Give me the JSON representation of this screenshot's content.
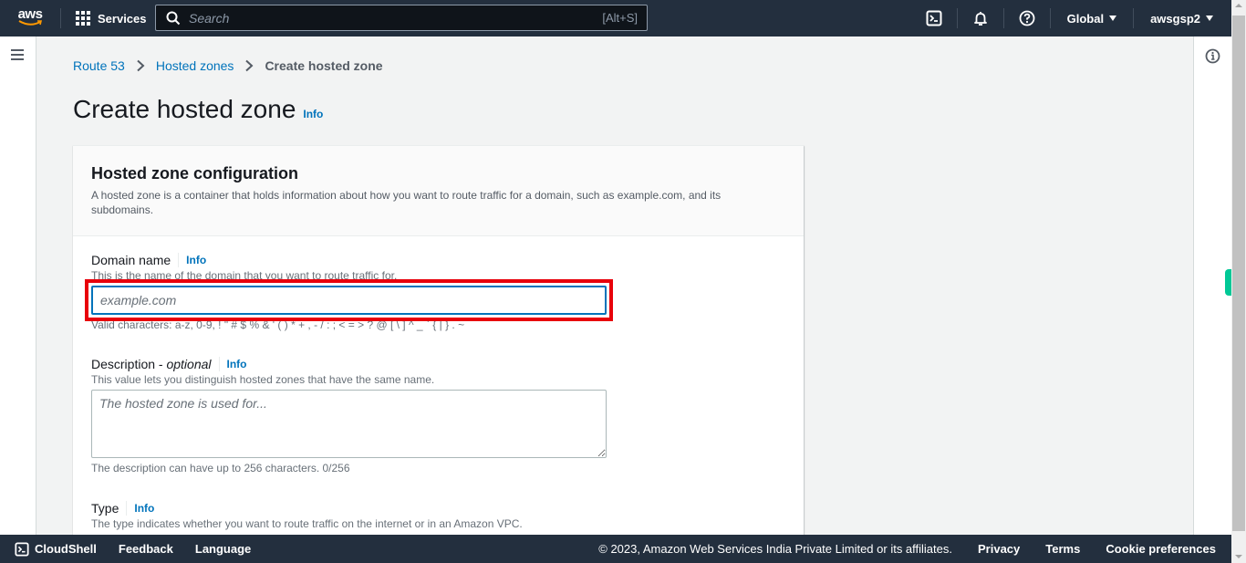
{
  "topnav": {
    "logo_text": "aws",
    "services_label": "Services",
    "search_placeholder": "Search",
    "search_shortcut": "[Alt+S]",
    "region_label": "Global",
    "account_label": "awsgsp2",
    "icons": [
      "cloudshell-icon",
      "notifications-bell-icon",
      "help-icon"
    ]
  },
  "breadcrumb": [
    {
      "label": "Route 53",
      "link": true
    },
    {
      "label": "Hosted zones",
      "link": true
    },
    {
      "label": "Create hosted zone",
      "link": false
    }
  ],
  "page": {
    "title": "Create hosted zone",
    "info_label": "Info"
  },
  "panel": {
    "title": "Hosted zone configuration",
    "description": "A hosted zone is a container that holds information about how you want to route traffic for a domain, such as example.com, and its subdomains."
  },
  "fields": {
    "domain": {
      "label": "Domain name",
      "info_label": "Info",
      "description": "This is the name of the domain that you want to route traffic for.",
      "value": "",
      "placeholder": "example.com",
      "constraint": "Valid characters: a-z, 0-9, ! \" # $ % & ' ( ) * + , - / : ; < = > ? @ [ \\ ] ^ _ ` { | } . ~",
      "highlighted": true
    },
    "description": {
      "label": "Description - ",
      "label_optional": "optional",
      "info_label": "Info",
      "description": "This value lets you distinguish hosted zones that have the same name.",
      "value": "",
      "placeholder": "The hosted zone is used for...",
      "constraint": "The description can have up to 256 characters. 0/256"
    },
    "type": {
      "label": "Type",
      "info_label": "Info",
      "description": "The type indicates whether you want to route traffic on the internet or in an Amazon VPC."
    }
  },
  "footer": {
    "cloudshell_label": "CloudShell",
    "feedback_label": "Feedback",
    "language_label": "Language",
    "copyright": "© 2023, Amazon Web Services India Private Limited or its affiliates.",
    "privacy_label": "Privacy",
    "terms_label": "Terms",
    "cookie_label": "Cookie preferences"
  },
  "colors": {
    "nav_bg": "#232f3e",
    "link": "#0073bb",
    "highlight": "#e8000b",
    "feedback_tab": "#00c896"
  }
}
